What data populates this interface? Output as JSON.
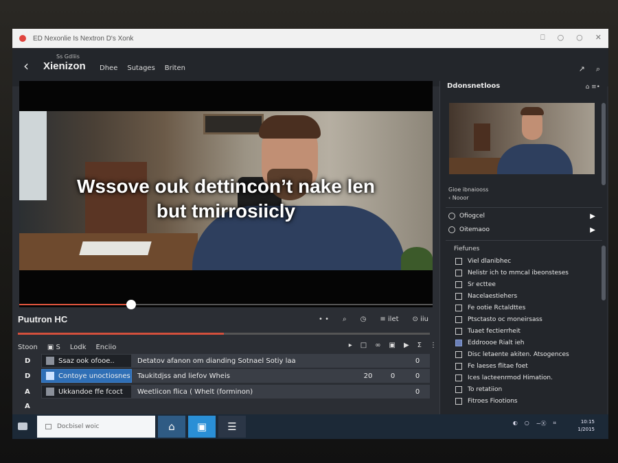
{
  "window": {
    "title": "ED Nexonlie Is Nextron D's Xonk",
    "controls": [
      "⎕",
      "○",
      "○",
      "✕"
    ]
  },
  "header": {
    "back_label": "‹",
    "subbrand": "Ss Gdliis",
    "brand": "Xienizon",
    "nav": [
      "Dhee",
      "Sutages",
      "Briten"
    ],
    "icons": [
      "↗",
      "⌕"
    ]
  },
  "player": {
    "caption_line1": "Wssove ouk dettincon’t nake len",
    "caption_line2": "but tmirrosiicly",
    "seek_progress": 0.27,
    "title": "Puutron HC",
    "controls": [
      "• •",
      "⌕",
      "◷",
      "≡ ilet",
      "⊙ iiu"
    ],
    "secondary_progress": 0.5
  },
  "queue": {
    "headers": [
      "Stoon",
      "▣ S",
      "Lodk",
      "Enciio"
    ],
    "tools": [
      "▸",
      "□",
      "∞",
      "▣",
      "▶",
      "Σ",
      "⋮"
    ],
    "rows": [
      {
        "key": "D",
        "name": "Ssaz ook ofooe..",
        "desc": "Detatov afanon om dianding Sotnael Sotiy laa",
        "n1": "",
        "n2": "",
        "n3": "0",
        "selected": false
      },
      {
        "key": "D",
        "name": "Contoye unoctiosnes",
        "desc": "Taukitdjss and liefov Wheis",
        "n1": "20",
        "n2": "0",
        "n3": "0",
        "selected": true
      },
      {
        "key": "A",
        "name": "Ukkandoe ffe fcoct",
        "desc": "Weetlicon flica ( Whelt (forminon)",
        "n1": "",
        "n2": "",
        "n3": "0",
        "selected": false
      }
    ],
    "extra_key": "A"
  },
  "side": {
    "title": "Ddonsnetloos",
    "title_icons": "⌂ ≡•",
    "meta1": "Gioe ibnaiooss",
    "meta2": "‹ Nooor",
    "items": [
      {
        "label": "Ofiogcel"
      },
      {
        "label": "Oitemaoo"
      }
    ],
    "features_title": "Fiefunes",
    "features": [
      {
        "label": "Viel dlanibhec",
        "checked": false
      },
      {
        "label": "Nelistr ich to mmcal ibeonsteses",
        "checked": false
      },
      {
        "label": "Sr ecttee",
        "checked": false
      },
      {
        "label": "Nacelaestiehers",
        "checked": false
      },
      {
        "label": "Fe ootie Rctaldttes",
        "checked": false
      },
      {
        "label": "Ptsctasto oc moneirsass",
        "checked": false
      },
      {
        "label": "Tuaet fectierrheit",
        "checked": false
      },
      {
        "label": "Eddroooe Rialt ieh",
        "checked": true
      },
      {
        "label": "Disc letaente akiten. Atsogences",
        "checked": false
      },
      {
        "label": "Fe laeses flitae foet",
        "checked": false
      },
      {
        "label": "Ices lacteenrmod Himation.",
        "checked": false
      },
      {
        "label": "To retatiion",
        "checked": false
      },
      {
        "label": "Fitroes Fiootions",
        "checked": false
      }
    ]
  },
  "taskbar": {
    "search_placeholder": "Docbisel woic",
    "apps": [
      "⌂",
      "▣",
      "☰"
    ],
    "tray": [
      "◐",
      "○",
      "∼Ⓧ",
      "⌗"
    ],
    "clock_time": "10:15",
    "clock_date": "1/2015"
  }
}
